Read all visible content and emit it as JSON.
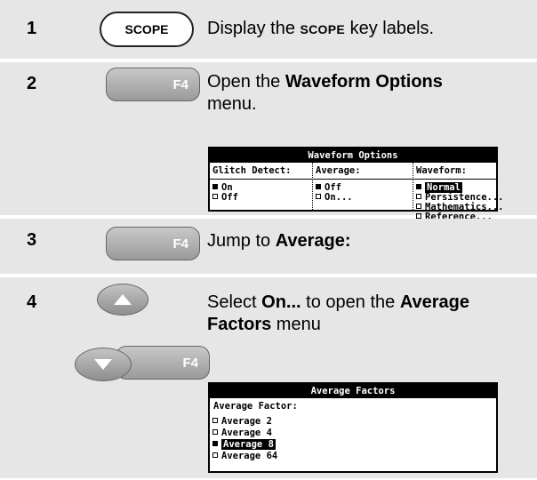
{
  "steps": [
    {
      "number": "1",
      "key": "SCOPE",
      "text_pre": "Display the ",
      "text_key": "SCOPE",
      "text_post": " key labels."
    },
    {
      "number": "2",
      "key": "F4",
      "text_pre": "Open the ",
      "text_bold": "Waveform Options",
      "text_post": " menu."
    },
    {
      "number": "3",
      "key": "F4",
      "text_pre": "Jump to ",
      "text_bold": "Average:"
    },
    {
      "number": "4",
      "key": "F4",
      "text_pre": "Select ",
      "text_bold1": "On...",
      "text_mid": " to open the ",
      "text_bold2": "Average Factors",
      "text_post": " menu"
    }
  ],
  "waveform_menu": {
    "title": "Waveform Options",
    "columns": [
      {
        "header": "Glitch Detect:",
        "options": [
          {
            "label": "On",
            "selected": true
          },
          {
            "label": "Off",
            "selected": false
          }
        ]
      },
      {
        "header": "Average:",
        "options": [
          {
            "label": "Off",
            "selected": true
          },
          {
            "label": "On...",
            "selected": false
          }
        ]
      },
      {
        "header": "Waveform:",
        "options": [
          {
            "label": "Normal",
            "selected": true
          },
          {
            "label": "Persistence...",
            "selected": false
          },
          {
            "label": "Mathematics...",
            "selected": false
          },
          {
            "label": "Reference...",
            "selected": false
          }
        ]
      }
    ]
  },
  "average_menu": {
    "title": "Average Factors",
    "header": "Average Factor:",
    "options": [
      {
        "label": "Average 2",
        "selected": false
      },
      {
        "label": "Average 4",
        "selected": false
      },
      {
        "label": "Average 8",
        "selected": true
      },
      {
        "label": "Average 64",
        "selected": false
      }
    ]
  }
}
